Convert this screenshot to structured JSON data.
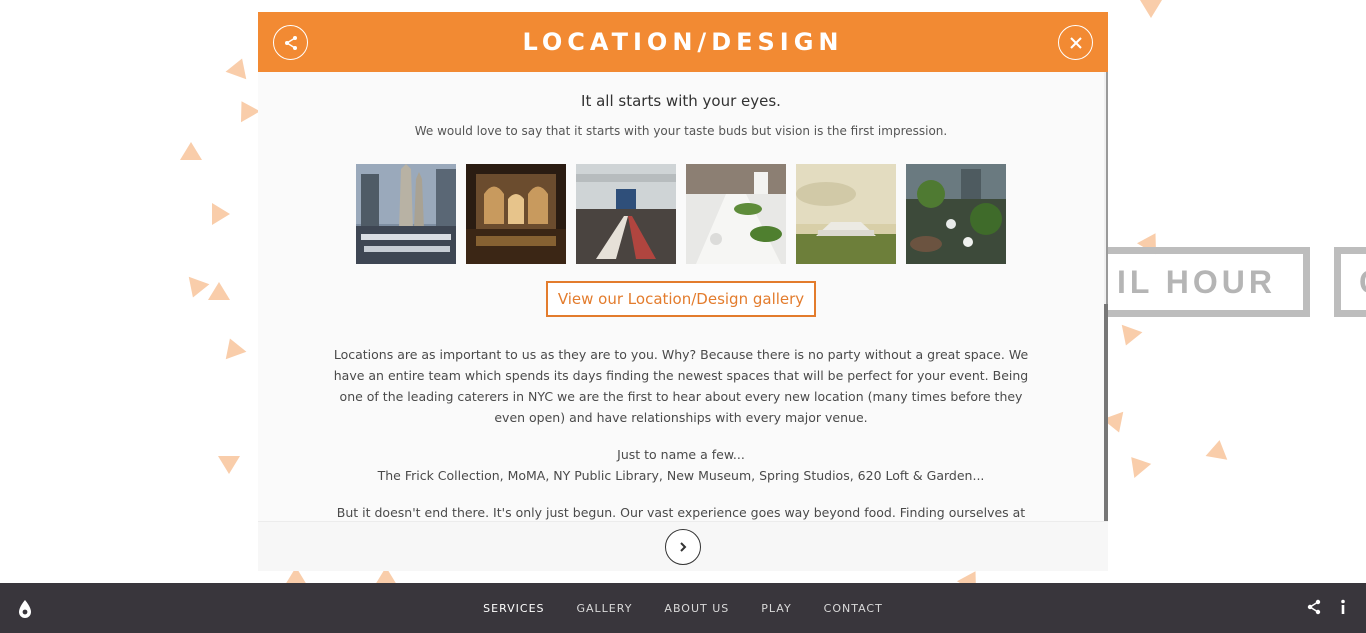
{
  "background": {
    "tag_1": "IL HOUR",
    "tag_2": "C"
  },
  "modal": {
    "title": "LOCATION/DESIGN",
    "headline": "It all starts with your eyes.",
    "subline": "We would love to say that it starts with your taste buds but vision is the first impression.",
    "gallery_button": "View our Location/Design gallery",
    "paragraph_1": "Locations are as important to us as they are to you.  Why?  Because there is no party without a great space.  We have an entire team which spends its days finding the newest spaces that will be perfect for your event.  Being one of the leading caterers in NYC we are the first to hear about every new location (many times before they even open) and have relationships with every major venue.",
    "paragraph_2_line_1": "Just to name a few...",
    "paragraph_2_line_2": "The Frick Collection, MoMA, NY Public Library, New Museum, Spring Studios, 620 Loft & Garden...",
    "paragraph_3": "But it doesn't end there.  It's only just begun.  Our vast experience goes way beyond food.  Finding ourselves at",
    "icons": {
      "share": "share-icon",
      "close": "close-icon",
      "next": "chevron-right-icon"
    }
  },
  "nav": {
    "items": [
      {
        "label": "SERVICES",
        "active": true
      },
      {
        "label": "GALLERY",
        "active": false
      },
      {
        "label": "ABOUT US",
        "active": false
      },
      {
        "label": "PLAY",
        "active": false
      },
      {
        "label": "CONTACT",
        "active": false
      }
    ]
  },
  "colors": {
    "accent": "#f28a33",
    "navbar": "#39363c",
    "triangle": "#f9cdaa"
  }
}
